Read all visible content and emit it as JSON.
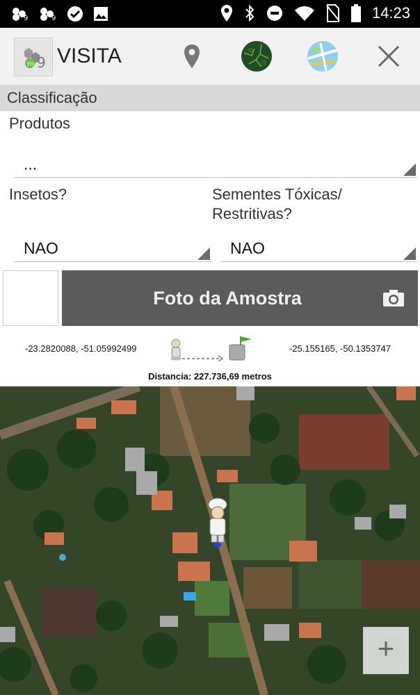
{
  "status_bar": {
    "time": "14:23",
    "icons": [
      "m9-notification-icon",
      "m9-notification-icon",
      "check-icon",
      "image-icon",
      "location-icon",
      "bluetooth-icon",
      "do-not-disturb-icon",
      "wifi-icon",
      "no-sim-icon",
      "battery-icon"
    ]
  },
  "app_bar": {
    "title": "VISITA",
    "actions": [
      "location-pin-icon",
      "satellite-map-icon",
      "street-map-icon",
      "close-icon"
    ]
  },
  "section": {
    "title": "Classificação"
  },
  "form": {
    "produtos_label": "Produtos",
    "produtos_value": "...",
    "insetos_label": "Insetos?",
    "insetos_value": "NAO",
    "sementes_label_line1": "Sementes Tóxicas/",
    "sementes_label_line2": "Restritivas?",
    "sementes_value": "NAO",
    "photo_button_label": "Foto da Amostra"
  },
  "route": {
    "origin_coords": "-23.2820088, -51.05992499",
    "destination_coords": "-25.155165, -50.1353747",
    "distance_text": "Distancia: 227.736,69 metros"
  },
  "map": {
    "zoom_in_label": "+"
  }
}
